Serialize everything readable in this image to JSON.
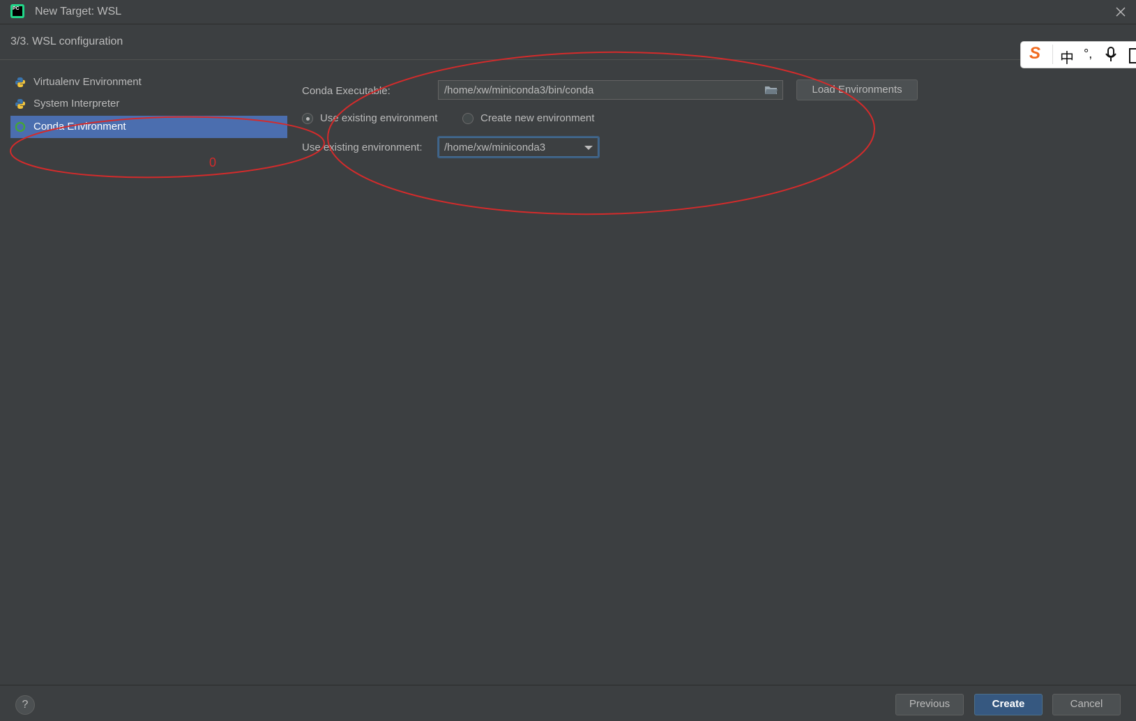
{
  "window": {
    "title": "New Target: WSL",
    "logo_text": "PC",
    "close_icon": "close-icon"
  },
  "step": {
    "title": "3/3. WSL configuration"
  },
  "ime_toolbar": {
    "logo": "S",
    "lang_label": "中",
    "punct_label": "°,"
  },
  "sidebar": {
    "items": [
      {
        "label": "Virtualenv Environment",
        "icon": "python-icon",
        "selected": false
      },
      {
        "label": "System Interpreter",
        "icon": "python-icon",
        "selected": false
      },
      {
        "label": "Conda Environment",
        "icon": "conda-icon",
        "selected": true
      }
    ]
  },
  "form": {
    "conda_executable_label": "Conda Executable:",
    "conda_executable_value": "/home/xw/miniconda3/bin/conda",
    "load_button_label": "Load Environments",
    "radio_existing_label": "Use existing environment",
    "radio_new_label": "Create new environment",
    "radio_selected": "existing",
    "existing_env_label": "Use existing environment:",
    "existing_env_value": "/home/xw/miniconda3"
  },
  "annotation": {
    "mark_text": "0"
  },
  "footer": {
    "help_label": "?",
    "previous_label": "Previous",
    "create_label": "Create",
    "cancel_label": "Cancel"
  },
  "colors": {
    "background": "#3c3f41",
    "selection": "#4b6eaf",
    "primary_button": "#365880",
    "annotation": "#d42b2b"
  }
}
